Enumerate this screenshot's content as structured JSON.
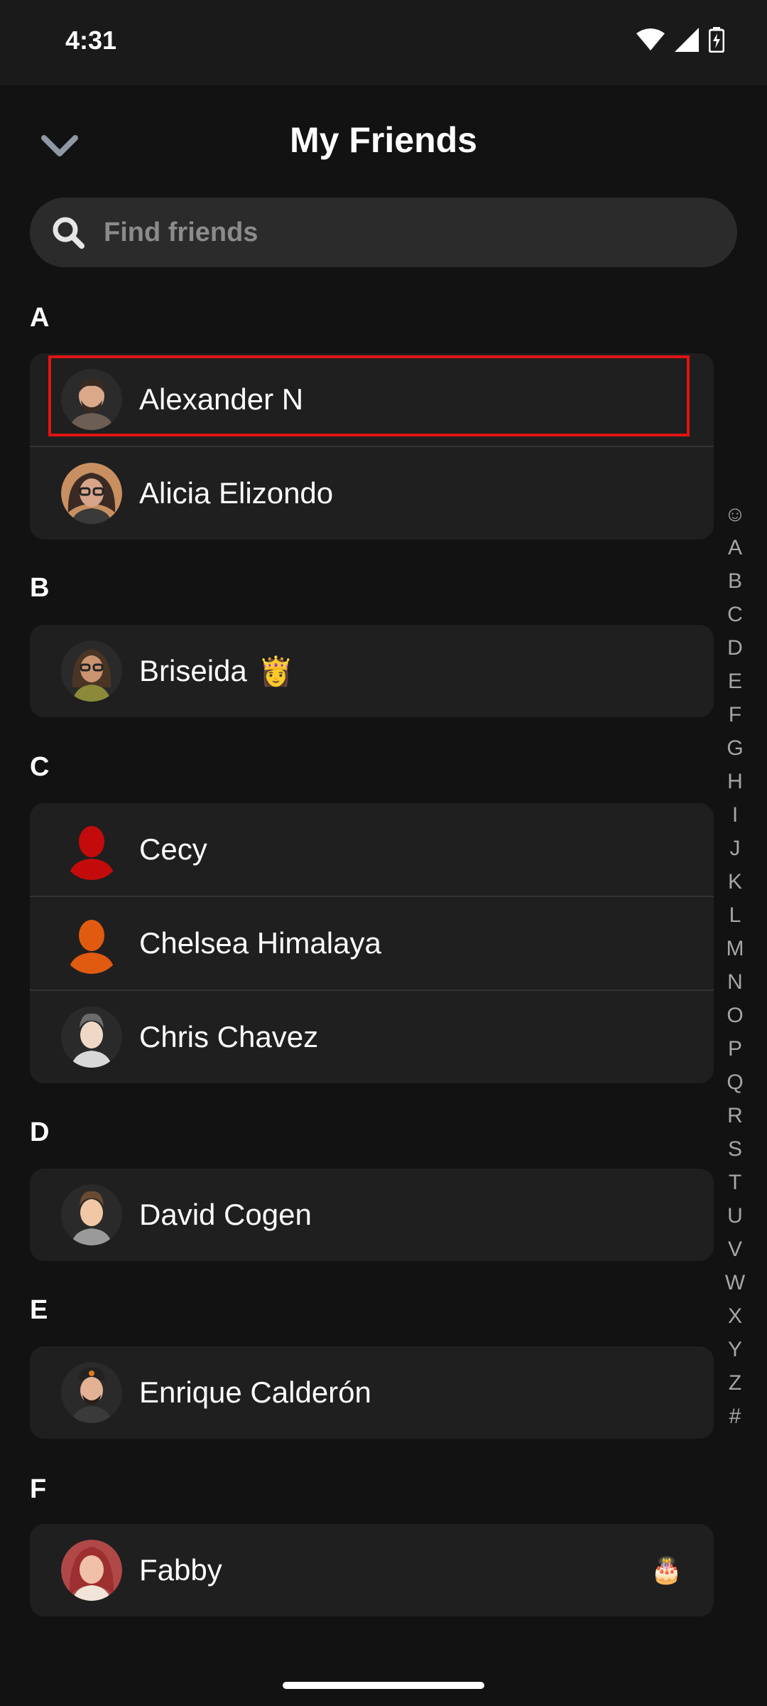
{
  "status": {
    "time": "4:31"
  },
  "header": {
    "title": "My Friends"
  },
  "search": {
    "placeholder": "Find friends"
  },
  "sections": [
    {
      "letter": "A",
      "friends": [
        {
          "name": "Alexander N"
        },
        {
          "name": "Alicia Elizondo"
        }
      ]
    },
    {
      "letter": "B",
      "friends": [
        {
          "name": "Briseida",
          "emoji": "👸"
        }
      ]
    },
    {
      "letter": "C",
      "friends": [
        {
          "name": "Cecy"
        },
        {
          "name": "Chelsea Himalaya"
        },
        {
          "name": "Chris Chavez"
        }
      ]
    },
    {
      "letter": "D",
      "friends": [
        {
          "name": "David Cogen"
        }
      ]
    },
    {
      "letter": "E",
      "friends": [
        {
          "name": "Enrique Calderón"
        }
      ]
    },
    {
      "letter": "F",
      "friends": [
        {
          "name": "Fabby",
          "trailing_emoji": "🎂"
        }
      ]
    }
  ],
  "alpha_index": [
    "☺",
    "A",
    "B",
    "C",
    "D",
    "E",
    "F",
    "G",
    "H",
    "I",
    "J",
    "K",
    "L",
    "M",
    "N",
    "O",
    "P",
    "Q",
    "R",
    "S",
    "T",
    "U",
    "V",
    "W",
    "X",
    "Y",
    "Z",
    "#"
  ],
  "colors": {
    "background": "#121212",
    "card": "#1f1f1f",
    "highlight": "#e11313",
    "avatar_cecy": "#c40b0b",
    "avatar_chelsea": "#e05a10"
  }
}
